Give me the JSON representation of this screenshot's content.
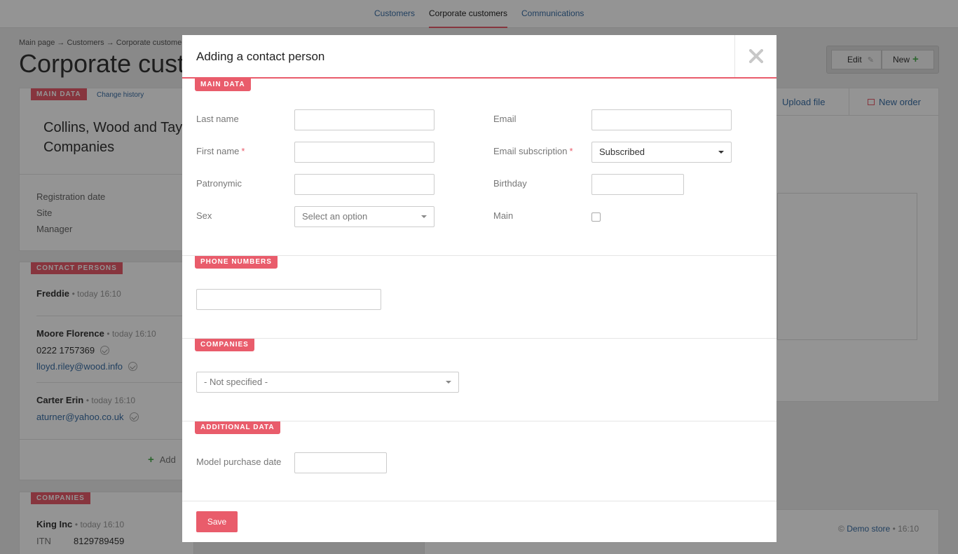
{
  "topnav": {
    "items": [
      "Customers",
      "Corporate customers",
      "Communications"
    ]
  },
  "background": {
    "breadcrumb": "Main page → Customers → Corporate customers",
    "page_title": "Corporate customers",
    "main_card": {
      "tag": "MAIN DATA",
      "change_history": "Change history",
      "company_name_line1": "Collins, Wood and Taylor",
      "company_name_line2": "Companies",
      "fields": [
        "Registration date",
        "Site",
        "Manager"
      ]
    },
    "contacts_card": {
      "tag": "CONTACT PERSONS",
      "persons": [
        {
          "name": "Freddie",
          "time": "today 16:10"
        },
        {
          "name": "Moore Florence",
          "time": "today 16:10",
          "phone": "0222 1757369",
          "email": "lloyd.riley@wood.info"
        },
        {
          "name": "Carter Erin",
          "time": "today 16:10",
          "email": "aturner@yahoo.co.uk"
        }
      ],
      "add_label": "Add"
    },
    "companies_card": {
      "tag": "COMPANIES",
      "company_name": "King Inc",
      "time": "today 16:10",
      "itn_label": "ITN",
      "itn_value": "8129789459"
    },
    "toolbar": {
      "edit_label": "Edit",
      "new_label": "New"
    },
    "right_bar": {
      "upload_label": "Upload file",
      "new_order_label": "New order"
    },
    "store": {
      "name": "Demo store",
      "time": "16:10"
    }
  },
  "modal": {
    "title": "Adding a contact person",
    "main_data": {
      "tag": "MAIN DATA",
      "last_name_label": "Last name",
      "last_name_value": "",
      "first_name_label": "First name",
      "first_name_value": "",
      "patronymic_label": "Patronymic",
      "patronymic_value": "",
      "sex_label": "Sex",
      "sex_value": "Select an option",
      "email_label": "Email",
      "email_value": "",
      "email_subscription_label": "Email subscription",
      "email_subscription_value": "Subscribed",
      "birthday_label": "Birthday",
      "birthday_value": "",
      "main_label": "Main",
      "required_mark": "*"
    },
    "phone_numbers": {
      "tag": "PHONE NUMBERS",
      "phone_value": ""
    },
    "companies": {
      "tag": "COMPANIES",
      "company_value": "- Not specified -"
    },
    "additional_data": {
      "tag": "ADDITIONAL DATA",
      "model_purchase_date_label": "Model purchase date",
      "model_purchase_date_value": ""
    },
    "save_label": "Save"
  },
  "colors": {
    "accent": "#e95c6b",
    "link": "#3a6ea5",
    "plus": "#4caf50"
  }
}
